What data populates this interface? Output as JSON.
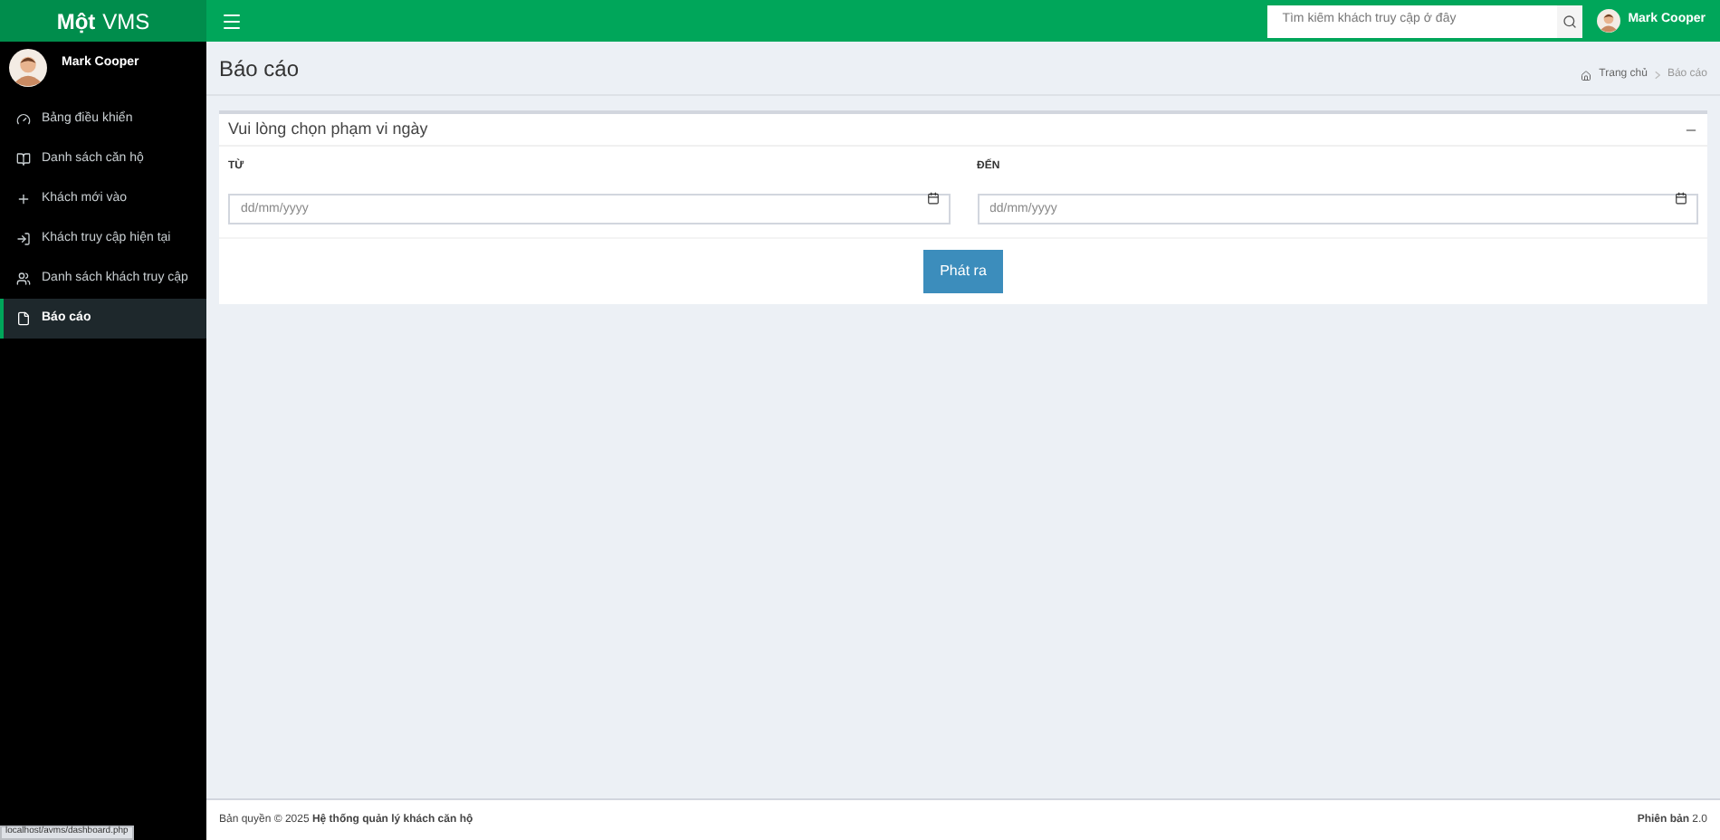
{
  "brand": {
    "prefix": "Một",
    "name": "VMS"
  },
  "top_user": {
    "name": "Mark Cooper"
  },
  "sidebar_user": {
    "name": "Mark Cooper"
  },
  "search": {
    "placeholder": "Tìm kiếm khách truy cập ở đây"
  },
  "sidebar": {
    "items": [
      {
        "label": "Bảng điều khiển",
        "selected": false
      },
      {
        "label": "Danh sách căn hộ",
        "selected": false
      },
      {
        "label": "Khách mới vào",
        "selected": false
      },
      {
        "label": "Khách truy cập hiện tại",
        "selected": false
      },
      {
        "label": "Danh sách khách truy cập",
        "selected": false
      },
      {
        "label": "Báo cáo",
        "selected": true
      }
    ]
  },
  "page": {
    "title": "Báo cáo",
    "breadcrumb": [
      "Trang chủ",
      "Báo cáo"
    ]
  },
  "panel": {
    "title": "Vui lòng chọn phạm vi ngày",
    "fields": [
      {
        "label": "TỪ",
        "placeholder": "dd/mm/yyyy"
      },
      {
        "label": "ĐẾN",
        "placeholder": "dd/mm/yyyy"
      }
    ],
    "button": "Phát ra"
  },
  "footer": {
    "prefix": "Bản quyền © 2025",
    "name": "Hệ thống quản lý khách căn hộ",
    "version_label": "Phiên bản",
    "version": "2.0"
  },
  "status_url": "localhost/avms/dashboard.php"
}
